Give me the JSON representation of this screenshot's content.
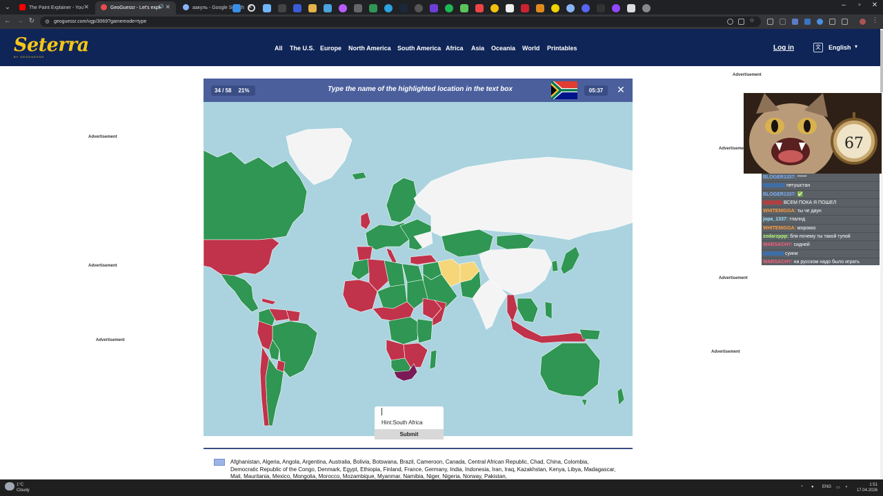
{
  "browser": {
    "tabs": [
      {
        "title": "The Paint Explainer - YouTube",
        "favicon_color": "#ff0000"
      },
      {
        "title": "GeoGuessr - Let's explore t",
        "favicon_color": "#e84c4c"
      },
      {
        "title": "аакуль - Google Search",
        "favicon_color": "#8ab4f8"
      }
    ],
    "new_tab": "+",
    "url": "geoguessr.com/vgp/3069?gamemode=type"
  },
  "site": {
    "logo": "Seterra",
    "logo_sub": "BY GEOGUESSR",
    "nav": [
      "All",
      "The U.S.",
      "Europe",
      "North America",
      "South America",
      "Africa",
      "Asia",
      "Oceania",
      "World",
      "Printables"
    ],
    "login": "Log in",
    "language": "English"
  },
  "ads": {
    "label": "Advertisement"
  },
  "game": {
    "progress": "34 / 58",
    "percent": "21%",
    "prompt": "Type the name of the highlighted location in the text box",
    "flag_of": "South Africa",
    "timer": "05:37",
    "input_value": "",
    "hint": "Hint:South Africa",
    "submit": "Submit",
    "answers_text": "Afghanistan, Algeria, Angola, Argentina, Australia, Bolivia, Botswana, Brazil, Cameroon, Canada, Central African Republic, Chad, China, Colombia, Democratic Republic of the Congo, Denmark, Egypt, Ethiopia, Finland, France, Germany, India, Indonesia, Iran, Iraq, Kazakhstan, Kenya, Libya, Madagascar, Mali, Mauritania, Mexico, Mongolia, Morocco, Mozambique, Myanmar, Namibia, Niger, Nigeria, Norway, Pakistan,",
    "colors": {
      "correct": "#2f9653",
      "wrong": "#c0334a",
      "highlight": "#7a1a57",
      "partial": "#f5d77a",
      "unanswered": "#f4f4f4",
      "ocean": "#aad3df"
    }
  },
  "chat": [
    {
      "user": "BLOGER1337:",
      "msg": "*****",
      "color": "#7fb3ff"
    },
    {
      "user": "",
      "msg": "петушстан",
      "color": "#7fb3ff"
    },
    {
      "user": "BLOGER1337:",
      "msg": "✅",
      "color": "#7fb3ff"
    },
    {
      "user": "",
      "msg": "ВСЕМ ПОКА Я ПОШЕЛ",
      "color": "#ff6b6b"
    },
    {
      "user": "WHITENIGGA:",
      "msg": "ты че даун",
      "color": "#ff9c3a"
    },
    {
      "user": "jopa_1337:",
      "msg": "тпалнд",
      "color": "#9be7ff"
    },
    {
      "user": "WHITENIGGA:",
      "msg": "морокко",
      "color": "#ff9c3a"
    },
    {
      "user": "zodarzppp:",
      "msg": "бля почему ты такой тупой",
      "color": "#b9ff7a"
    },
    {
      "user": "WARSACHY:",
      "msg": "сидней",
      "color": "#ff5d7a"
    },
    {
      "user": "",
      "msg": "суини",
      "color": "#7fb3ff"
    },
    {
      "user": "WARSACHY:",
      "msg": "на русском надо было играть",
      "color": "#ff5d7a"
    }
  ],
  "taskbar": {
    "weather_temp": "1°C",
    "weather_text": "Cloudy",
    "lang": "ENG",
    "time": "1:51",
    "date": "17.04.2026"
  }
}
